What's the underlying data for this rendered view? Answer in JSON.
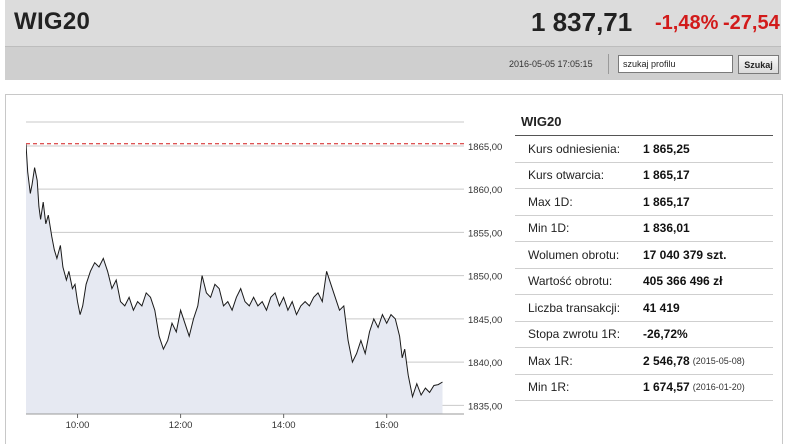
{
  "header": {
    "title": "WIG20",
    "price": "1 837,71",
    "change_pct": "-1,48%",
    "change_abs": "-27,54",
    "timestamp": "2016-05-05 17:05:15",
    "search_value": "szukaj profilu",
    "search_button": "Szukaj"
  },
  "stats": {
    "title": "WIG20",
    "rows": [
      {
        "label": "Kurs odniesienia:",
        "value": "1 865,25",
        "date": ""
      },
      {
        "label": "Kurs otwarcia:",
        "value": "1 865,17",
        "date": ""
      },
      {
        "label": "Max 1D:",
        "value": "1 865,17",
        "date": ""
      },
      {
        "label": "Min 1D:",
        "value": "1 836,01",
        "date": ""
      },
      {
        "label": "Wolumen obrotu:",
        "value": "17 040 379 szt.",
        "date": ""
      },
      {
        "label": "Wartość obrotu:",
        "value": "405 366 496 zł",
        "date": ""
      },
      {
        "label": "Liczba transakcji:",
        "value": "41 419",
        "date": ""
      },
      {
        "label": "Stopa zwrotu 1R:",
        "value": "-26,72%",
        "date": ""
      },
      {
        "label": "Max 1R:",
        "value": "2 546,78",
        "date": "(2015-05-08)"
      },
      {
        "label": "Min 1R:",
        "value": "1 674,57",
        "date": "(2016-01-20)"
      }
    ]
  },
  "colors": {
    "negative": "#d21b1b",
    "area_fill": "#e6e9f2",
    "reference_line": "#d21b1b"
  },
  "chart_data": {
    "type": "area",
    "title": "",
    "xlabel": "",
    "ylabel": "",
    "x_ticks": [
      "10:00",
      "12:00",
      "14:00",
      "16:00"
    ],
    "y_ticks": [
      "1835,00",
      "1840,00",
      "1845,00",
      "1850,00",
      "1855,00",
      "1860,00",
      "1865,00"
    ],
    "xlim": [
      "09:00",
      "17:30"
    ],
    "ylim": [
      1834,
      1868
    ],
    "reference_value": 1865.25,
    "grid": true,
    "series": [
      {
        "values": [
          [
            "09:00",
            1865.2
          ],
          [
            "09:02",
            1862.0
          ],
          [
            "09:05",
            1859.5
          ],
          [
            "09:07",
            1860.5
          ],
          [
            "09:10",
            1862.5
          ],
          [
            "09:13",
            1861.0
          ],
          [
            "09:15",
            1858.0
          ],
          [
            "09:17",
            1856.5
          ],
          [
            "09:20",
            1858.5
          ],
          [
            "09:23",
            1856.0
          ],
          [
            "09:26",
            1857.0
          ],
          [
            "09:30",
            1854.5
          ],
          [
            "09:33",
            1853.0
          ],
          [
            "09:36",
            1852.0
          ],
          [
            "09:40",
            1853.5
          ],
          [
            "09:43",
            1851.0
          ],
          [
            "09:47",
            1849.5
          ],
          [
            "09:50",
            1850.5
          ],
          [
            "09:54",
            1848.5
          ],
          [
            "09:57",
            1849.0
          ],
          [
            "10:00",
            1847.0
          ],
          [
            "10:03",
            1845.5
          ],
          [
            "10:06",
            1846.5
          ],
          [
            "10:10",
            1849.0
          ],
          [
            "10:15",
            1850.5
          ],
          [
            "10:20",
            1851.5
          ],
          [
            "10:25",
            1851.0
          ],
          [
            "10:30",
            1852.0
          ],
          [
            "10:35",
            1850.5
          ],
          [
            "10:40",
            1848.5
          ],
          [
            "10:45",
            1849.5
          ],
          [
            "10:50",
            1847.0
          ],
          [
            "10:55",
            1846.5
          ],
          [
            "11:00",
            1847.5
          ],
          [
            "11:05",
            1846.0
          ],
          [
            "11:10",
            1847.0
          ],
          [
            "11:15",
            1846.5
          ],
          [
            "11:20",
            1848.0
          ],
          [
            "11:25",
            1847.5
          ],
          [
            "11:30",
            1846.0
          ],
          [
            "11:35",
            1843.0
          ],
          [
            "11:40",
            1841.5
          ],
          [
            "11:45",
            1842.5
          ],
          [
            "11:50",
            1844.5
          ],
          [
            "11:55",
            1843.5
          ],
          [
            "12:00",
            1846.0
          ],
          [
            "12:05",
            1844.5
          ],
          [
            "12:10",
            1843.0
          ],
          [
            "12:15",
            1845.0
          ],
          [
            "12:20",
            1846.5
          ],
          [
            "12:25",
            1850.0
          ],
          [
            "12:30",
            1848.0
          ],
          [
            "12:35",
            1847.5
          ],
          [
            "12:40",
            1849.0
          ],
          [
            "12:45",
            1848.5
          ],
          [
            "12:50",
            1846.5
          ],
          [
            "12:55",
            1847.0
          ],
          [
            "13:00",
            1846.0
          ],
          [
            "13:05",
            1847.5
          ],
          [
            "13:10",
            1848.5
          ],
          [
            "13:15",
            1847.0
          ],
          [
            "13:20",
            1846.5
          ],
          [
            "13:25",
            1847.5
          ],
          [
            "13:30",
            1846.5
          ],
          [
            "13:35",
            1847.0
          ],
          [
            "13:40",
            1846.0
          ],
          [
            "13:45",
            1847.5
          ],
          [
            "13:50",
            1848.0
          ],
          [
            "13:55",
            1846.5
          ],
          [
            "14:00",
            1847.5
          ],
          [
            "14:05",
            1846.0
          ],
          [
            "14:10",
            1847.0
          ],
          [
            "14:15",
            1845.5
          ],
          [
            "14:20",
            1846.5
          ],
          [
            "14:25",
            1847.0
          ],
          [
            "14:30",
            1846.5
          ],
          [
            "14:35",
            1847.5
          ],
          [
            "14:40",
            1848.0
          ],
          [
            "14:45",
            1847.0
          ],
          [
            "14:50",
            1850.5
          ],
          [
            "14:55",
            1849.0
          ],
          [
            "15:00",
            1847.5
          ],
          [
            "15:05",
            1846.0
          ],
          [
            "15:10",
            1846.5
          ],
          [
            "15:15",
            1842.5
          ],
          [
            "15:20",
            1840.0
          ],
          [
            "15:25",
            1841.0
          ],
          [
            "15:30",
            1842.5
          ],
          [
            "15:35",
            1841.0
          ],
          [
            "15:40",
            1843.5
          ],
          [
            "15:45",
            1845.0
          ],
          [
            "15:50",
            1844.0
          ],
          [
            "15:55",
            1845.5
          ],
          [
            "16:00",
            1844.5
          ],
          [
            "16:05",
            1845.5
          ],
          [
            "16:10",
            1845.0
          ],
          [
            "16:15",
            1843.0
          ],
          [
            "16:18",
            1840.5
          ],
          [
            "16:21",
            1841.5
          ],
          [
            "16:25",
            1838.5
          ],
          [
            "16:30",
            1836.0
          ],
          [
            "16:35",
            1837.5
          ],
          [
            "16:40",
            1836.2
          ],
          [
            "16:45",
            1837.0
          ],
          [
            "16:50",
            1836.5
          ],
          [
            "16:55",
            1837.3
          ],
          [
            "17:00",
            1837.4
          ],
          [
            "17:05",
            1837.7
          ]
        ]
      }
    ]
  }
}
